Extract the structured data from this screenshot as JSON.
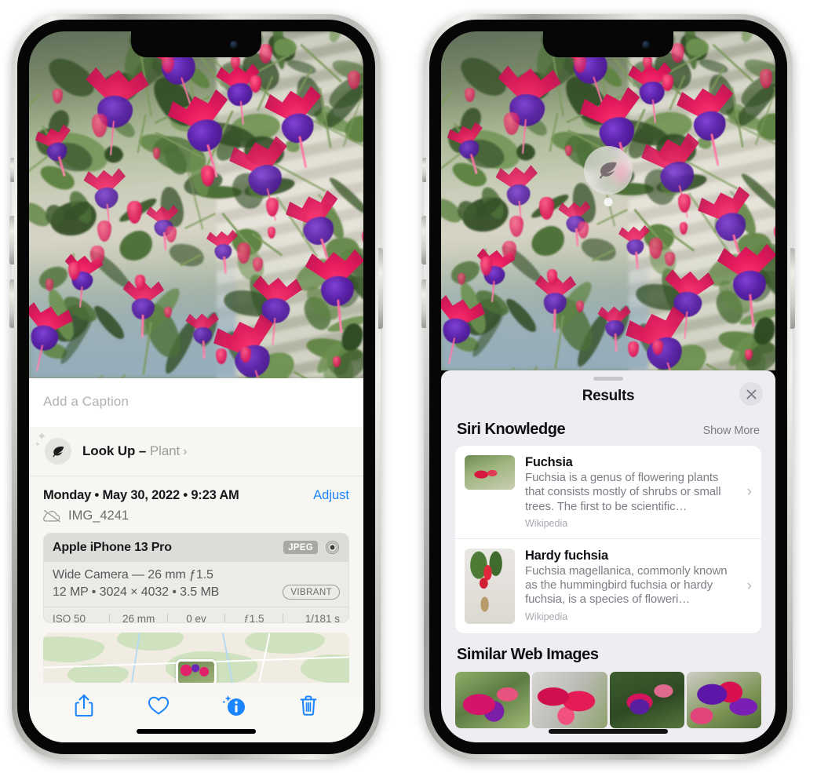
{
  "left_phone": {
    "caption_placeholder": "Add a Caption",
    "lookup": {
      "label": "Look Up – ",
      "subject": "Plant",
      "chevron": "›",
      "icon": "leaf-icon"
    },
    "date_text": "Monday • May 30, 2022 • 9:23 AM",
    "adjust_label": "Adjust",
    "file_name": "IMG_4241",
    "metadata": {
      "device": "Apple iPhone 13 Pro",
      "format_badge": "JPEG",
      "lens_line": "Wide Camera — 26 mm ƒ1.5",
      "size_line": "12 MP • 3024 × 4032 • 3.5 MB",
      "style_badge": "VIBRANT",
      "exif": [
        "ISO 50",
        "26 mm",
        "0 ev",
        "ƒ1.5",
        "1/181 s"
      ]
    },
    "toolbar": {
      "share_label": "share-icon",
      "favorite_label": "heart-icon",
      "info_label": "info-sparkle-icon",
      "delete_label": "trash-icon",
      "accent_color": "#1a85ff"
    }
  },
  "right_phone": {
    "visual_lookup_badge": "leaf-icon",
    "sheet": {
      "title": "Results",
      "close_label": "✕"
    },
    "siri_knowledge": {
      "title": "Siri Knowledge",
      "action": "Show More",
      "items": [
        {
          "title": "Fuchsia",
          "description": "Fuchsia is a genus of flowering plants that consists mostly of shrubs or small trees. The first to be scientific…",
          "source": "Wikipedia",
          "chevron": "›"
        },
        {
          "title": "Hardy fuchsia",
          "description": "Fuchsia magellanica, commonly known as the hummingbird fuchsia or hardy fuchsia, is a species of floweri…",
          "source": "Wikipedia",
          "chevron": "›"
        }
      ]
    },
    "similar_web_images": {
      "title": "Similar Web Images",
      "thumbnails": [
        "fuchsia-thumb-1",
        "fuchsia-thumb-2",
        "fuchsia-thumb-3",
        "fuchsia-thumb-4"
      ]
    }
  },
  "colors": {
    "ios_blue": "#1a85ff",
    "sheet_bg_left": "#f7f6f2",
    "sheet_bg_right": "#efedf2",
    "card_white": "#ffffff"
  }
}
